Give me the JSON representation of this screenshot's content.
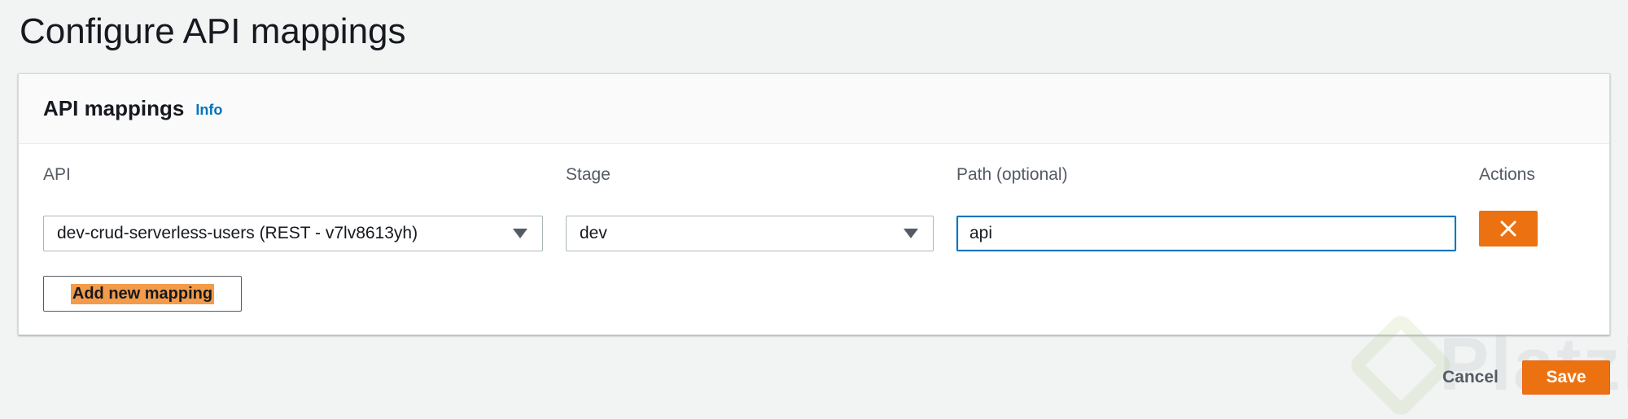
{
  "page": {
    "title": "Configure API mappings"
  },
  "panel": {
    "title": "API mappings",
    "info_link": "Info",
    "columns": {
      "api": "API",
      "stage": "Stage",
      "path": "Path (optional)",
      "actions": "Actions"
    },
    "mapping": {
      "api_value": "dev-crud-serverless-users (REST - v7lv8613yh)",
      "stage_value": "dev",
      "path_value": "api",
      "path_placeholder": ""
    },
    "add_button": "Add new mapping"
  },
  "footer": {
    "cancel_label": "Cancel",
    "save_label": "Save"
  },
  "watermark": {
    "text": "Platzi"
  },
  "icons": {
    "remove": "close-icon",
    "dropdown": "caret-down-icon"
  },
  "colors": {
    "accent": "#ec7211",
    "link": "#0073bb",
    "focus": "#0073bb",
    "highlight": "#f29b4a"
  }
}
